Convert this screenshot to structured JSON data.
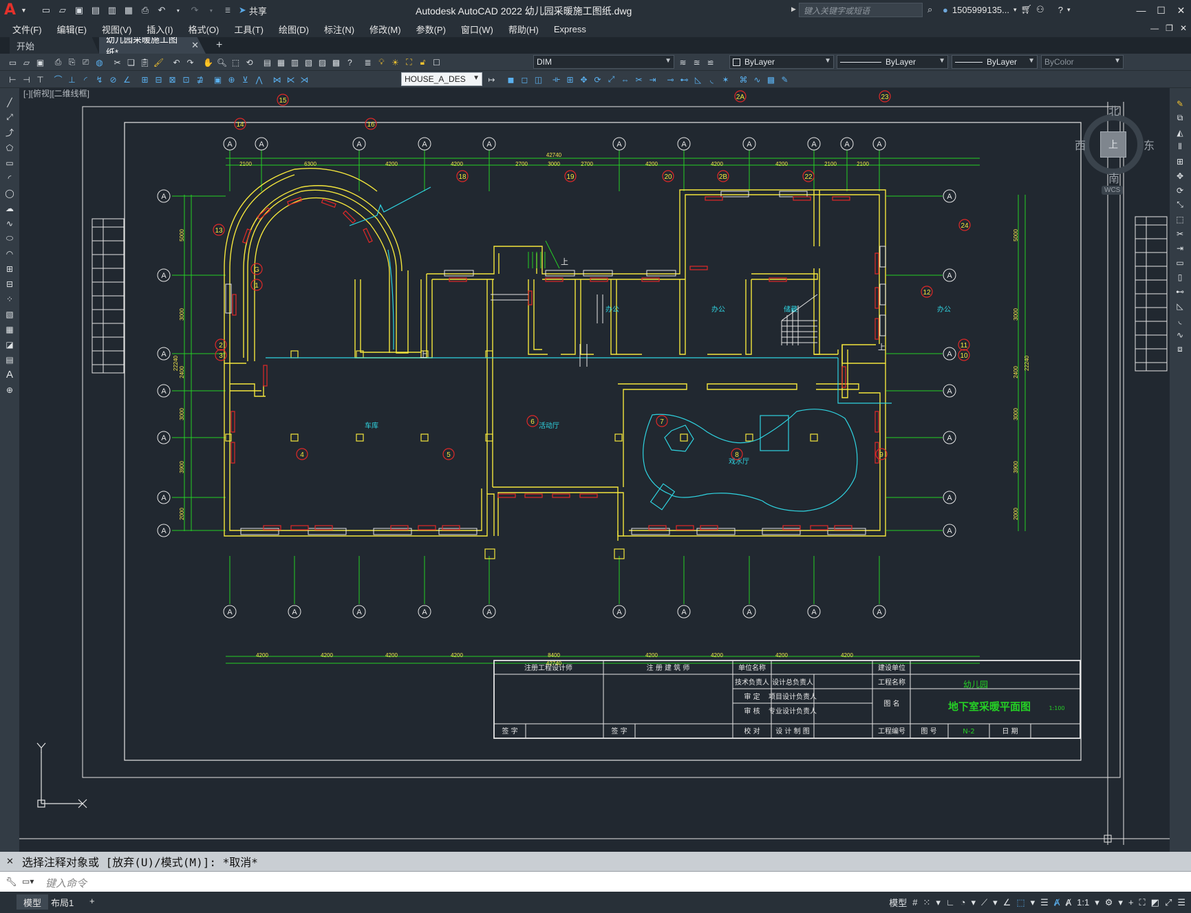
{
  "titlebar": {
    "app_logo": "A",
    "share_label": "共享",
    "title": "Autodesk AutoCAD 2022    幼儿园采暖施工图纸.dwg",
    "search_placeholder": "键入关键字或短语",
    "user": "1505999135...",
    "icons": [
      "new-icon",
      "open-icon",
      "save-icon",
      "saveas-icon",
      "plot-icon",
      "undo-icon",
      "redo-icon",
      "share-icon"
    ]
  },
  "menu": {
    "items": [
      "文件(F)",
      "编辑(E)",
      "视图(V)",
      "插入(I)",
      "格式(O)",
      "工具(T)",
      "绘图(D)",
      "标注(N)",
      "修改(M)",
      "参数(P)",
      "窗口(W)",
      "帮助(H)",
      "Express"
    ]
  },
  "tabs": {
    "start": "开始",
    "active": "幼儿园采暖施工图纸*"
  },
  "toolbar": {
    "layer": "DIM",
    "color": "ByLayer",
    "linetype": "ByLayer",
    "lineweight": "ByLayer",
    "plotstyle": "ByColor",
    "dimstyle": "HOUSE_A_DES"
  },
  "canvas": {
    "viewport_label": "[-][俯视][二维线框]",
    "compass": {
      "north": "北",
      "south": "南",
      "east": "东",
      "west": "西",
      "top": "上",
      "wcs": "WCS"
    },
    "ucs_y": "Y",
    "axis_letter": "A",
    "top_dims": [
      "2100",
      "6300",
      "4200",
      "4200",
      "2700",
      "3000",
      "2700",
      "4200",
      "4200",
      "4200",
      "2100",
      "2100"
    ],
    "top_total": "42740",
    "bottom_dims": [
      "4200",
      "4200",
      "4200",
      "4200",
      "8400",
      "4200",
      "4200",
      "4200",
      "4200"
    ],
    "bottom_total": "42740",
    "left_dims": [
      "5000",
      "3000",
      "2400",
      "3000",
      "3900",
      "2000"
    ],
    "left_total": "22240",
    "right_dims": [
      "5000",
      "3000",
      "2400",
      "3000",
      "3900",
      "2000"
    ],
    "right_total": "22240",
    "room_labels": {
      "garage": "车库",
      "hall": "活动厅",
      "pool": "戏水厅",
      "office1": "办公",
      "office2": "办公",
      "storage": "储藏",
      "office3": "办公"
    },
    "stair_up": "上",
    "radiator_numbers": [
      "1",
      "2",
      "3",
      "4",
      "5",
      "6",
      "7",
      "8",
      "9",
      "10",
      "11",
      "12",
      "13",
      "14",
      "15",
      "16",
      "18",
      "19",
      "20",
      "22",
      "23",
      "24",
      "2A",
      "2B",
      "G"
    ],
    "title_block": {
      "r1c1": "注册工程设计师",
      "r1c2": "注 册 建 筑 师",
      "unit_name": "单位名称",
      "build_unit": "建设单位",
      "tech_lead": "技术负责人",
      "design_lead": "设计总负责人",
      "project_name": "工程名称",
      "project_value": "幼儿园",
      "approve": "审    定",
      "proj_design_lead": "项目设计负责人",
      "drawing_name_label": "图    名",
      "drawing_name": "地下室采暖平面图",
      "scale": "1:100",
      "check": "审    核",
      "spec_lead": "专业设计负责人",
      "proofread": "校    对",
      "design_draw": "设 计 制 图",
      "project_no": "工程编号",
      "drawing_no_label": "图  号",
      "drawing_no": "N-2",
      "date_label": "日  期",
      "sign1": "签  字",
      "sign2": "签  字"
    }
  },
  "command": {
    "history": "选择注释对象或 [放弃(U)/模式(M)]: *取消*",
    "placeholder": "键入命令"
  },
  "statusbar": {
    "model_tab": "模型",
    "layout_tab": "布局1",
    "model_btn": "模型",
    "scale": "1:1"
  }
}
